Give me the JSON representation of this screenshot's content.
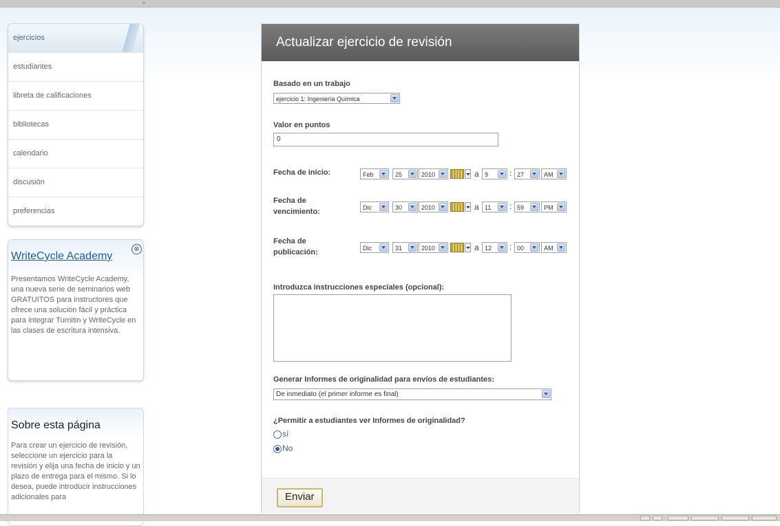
{
  "nav": {
    "items": [
      "ejercicios",
      "estudiantes",
      "libreta de calificaciones",
      "bibliotecas",
      "calendario",
      "discusión",
      "preferencias"
    ]
  },
  "promo": {
    "title": "WriteCycle Academy",
    "close_icon": "⊗",
    "text": "Presentamos WriteCycle Academy, una nueva serie de seminarios web GRATUITOS para instructores que ofrece una solución fácil y práctica para integrar Turnitin y WriteCycle en las clases de escritura intensiva."
  },
  "about": {
    "title": "Sobre esta página",
    "text": "Para crear un ejercicio de revisión, seleccione un ejercicio para la revisión y elija una fecha de inicio y un plazo de entrega para el mismo. Si lo desea, puede introducir instrucciones adicionales para"
  },
  "form": {
    "title": "Actualizar ejercicio de revisión",
    "based_label": "Basado en un trabajo",
    "based_value": "ejercicio 1: Ingeniería Química",
    "points_label": "Valor en puntos",
    "points_value": "0",
    "dates": [
      {
        "label1": "Fecha de inicio:",
        "label2": "",
        "month": "Feb",
        "day": "25",
        "year": "2010",
        "sep": "a",
        "hour": "9",
        "colon": ":",
        "minute": "27",
        "ampm": "AM"
      },
      {
        "label1": "Fecha de",
        "label2": "vencimiento:",
        "month": "Dic",
        "day": "30",
        "year": "2010",
        "sep": "a",
        "hour": "11",
        "colon": ":",
        "minute": "59",
        "ampm": "PM"
      },
      {
        "label1": "Fecha de",
        "label2": "publicación:",
        "month": "Dic",
        "day": "31",
        "year": "2010",
        "sep": "a",
        "hour": "12",
        "colon": ":",
        "minute": "00",
        "ampm": "AM"
      }
    ],
    "instructions_label": "Introduzca instrucciones especiales (opcional):",
    "reports_label": "Generar Informes de originalidad para envíos de estudiantes:",
    "reports_value": "De inmediato (el primer informe es final)",
    "allow_label": "¿Permitir a estudiantes ver Informes de originalidad?",
    "options": [
      "sí",
      "No"
    ],
    "selected_option": "No",
    "submit": "Enviar"
  }
}
